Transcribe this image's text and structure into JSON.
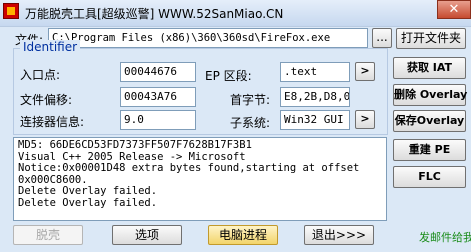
{
  "titlebar": {
    "title": "万能脱壳工具[超级巡警]  WWW.52SanMiao.CN",
    "close_glyph": "✕"
  },
  "file_row": {
    "label": "文件:",
    "path": "C:\\Program Files (x86)\\360\\360sd\\FireFox.exe",
    "browse_label": "...",
    "open_label": "打开文件夹"
  },
  "identifier": {
    "group_title": "Identifier",
    "entry_point_label": "入口点:",
    "entry_point_value": "00044676",
    "ep_section_label": "EP  区段:",
    "ep_section_value": ".text",
    "file_offset_label": "文件偏移:",
    "file_offset_value": "00043A76",
    "first_bytes_label": "首字节:",
    "first_bytes_value": "E8,2B,D8,00",
    "linker_label": "连接器信息:",
    "linker_value": "9.0",
    "subsystem_label": "子系统:",
    "subsystem_value": "Win32 GUI",
    "arrow_glyph": ">"
  },
  "log": {
    "lines": [
      "MD5: 66DE6CD53FD7373FF507F7628B17F3B1",
      "Visual C++ 2005 Release -> Microsoft",
      "Notice:0x00001D48 extra bytes found,starting at offset",
      "0x000C8600.",
      "Delete Overlay failed.",
      "Delete Overlay failed."
    ]
  },
  "side_buttons": {
    "get_iat": "获取 IAT",
    "delete_overlay": "删除 Overlay",
    "save_overlay": "保存Overlay",
    "rebuild_pe": "重建 PE",
    "flc": "FLC"
  },
  "bottom_bar": {
    "unpack": "脱壳",
    "options": "选项",
    "processes": "电脑进程",
    "exit": "退出>>>",
    "mail": "发邮件给我"
  }
}
